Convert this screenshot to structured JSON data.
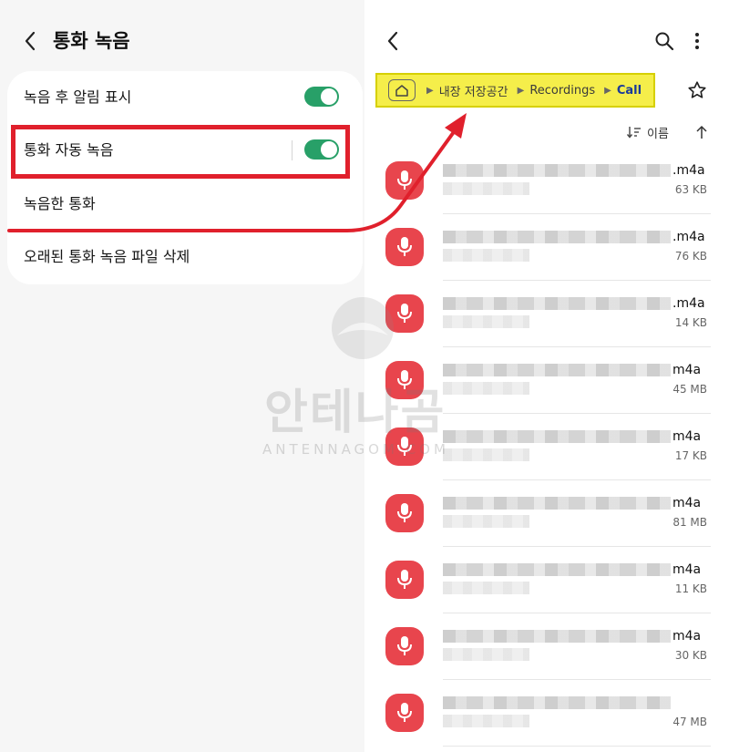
{
  "settings": {
    "title": "통화 녹음",
    "items": [
      {
        "label": "녹음 후 알림 표시",
        "toggle": true
      },
      {
        "label": "통화 자동 녹음",
        "toggle": true
      },
      {
        "label": "녹음한 통화"
      },
      {
        "label": "오래된 통화 녹음 파일 삭제"
      }
    ]
  },
  "files": {
    "breadcrumb": [
      "내장 저장공간",
      "Recordings",
      "Call"
    ],
    "sort_label": "이름",
    "items": [
      {
        "ext": ".m4a",
        "size": "63 KB"
      },
      {
        "ext": ".m4a",
        "size": "76 KB"
      },
      {
        "ext": ".m4a",
        "size": "14 KB"
      },
      {
        "ext": "m4a",
        "size": "45 MB"
      },
      {
        "ext": "m4a",
        "size": "17 KB"
      },
      {
        "ext": "m4a",
        "size": "81 MB"
      },
      {
        "ext": "m4a",
        "size": "11 KB"
      },
      {
        "ext": "m4a",
        "size": "30 KB"
      },
      {
        "ext": "",
        "size": "47 MB"
      }
    ]
  },
  "watermark": {
    "title": "안테나곰",
    "subtitle": "ANTENNAGOM.COM"
  },
  "colors": {
    "toggle_on": "#28a068",
    "mic_icon": "#e8454d",
    "highlight_red": "#e0202c",
    "breadcrumb_bg": "#f5ee4a"
  },
  "icons": [
    "back-arrow-icon",
    "search-icon",
    "more-vert-icon",
    "home-folder-icon",
    "star-icon",
    "sort-icon",
    "arrow-up-icon",
    "microphone-icon"
  ]
}
